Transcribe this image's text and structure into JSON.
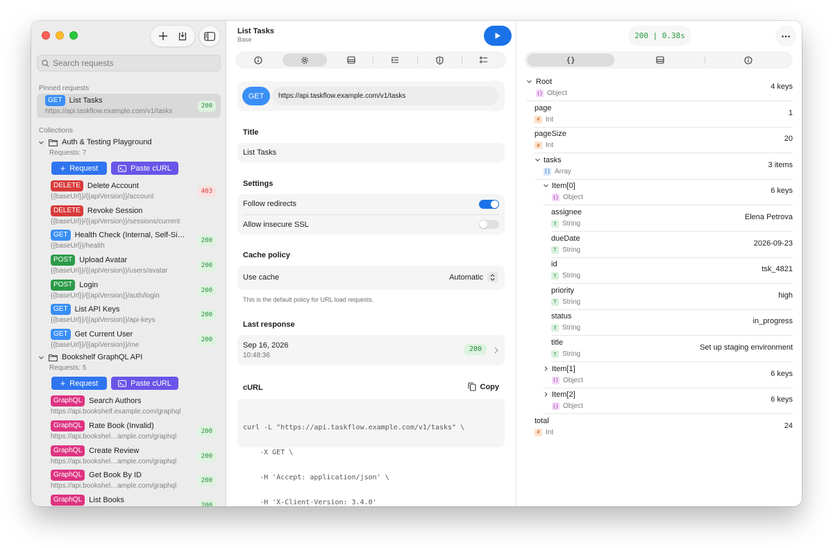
{
  "sidebar": {
    "search_placeholder": "Search requests",
    "pinned_label": "Pinned requests",
    "collections_label": "Collections",
    "pinned": {
      "method": "GET",
      "name": "List Tasks",
      "url": "https://api.taskflow.example.com/v1/tasks",
      "code": "200"
    },
    "collections": [
      {
        "name": "Auth & Testing Playground",
        "count": "Requests: 7",
        "request_btn": "Request",
        "curl_btn": "Paste cURL",
        "items": [
          {
            "method": "DELETE",
            "name": "Delete Account",
            "url": "{{baseUrl}}/{{apiVersion}}/account",
            "code": "403"
          },
          {
            "method": "DELETE",
            "name": "Revoke Session",
            "url": "{{baseUrl}}/{{apiVersion}}/sessions/current",
            "code": ""
          },
          {
            "method": "GET",
            "name": "Health Check (Internal, Self-Si…",
            "url": "{{baseUrl}}/health",
            "code": "200"
          },
          {
            "method": "POST",
            "name": "Upload Avatar",
            "url": "{{baseUrl}}/{{apiVersion}}/users/avatar",
            "code": "200"
          },
          {
            "method": "POST",
            "name": "Login",
            "url": "{{baseUrl}}/{{apiVersion}}/auth/login",
            "code": "200"
          },
          {
            "method": "GET",
            "name": "List API Keys",
            "url": "{{baseUrl}}/{{apiVersion}}/api-keys",
            "code": "200"
          },
          {
            "method": "GET",
            "name": "Get Current User",
            "url": "{{baseUrl}}/{{apiVersion}}/me",
            "code": "200"
          }
        ]
      },
      {
        "name": "Bookshelf GraphQL API",
        "count": "Requests: 5",
        "request_btn": "Request",
        "curl_btn": "Paste cURL",
        "items": [
          {
            "method": "GraphQL",
            "name": "Search Authors",
            "url": "https://api.bookshelf.example.com/graphql",
            "code": ""
          },
          {
            "method": "GraphQL",
            "name": "Rate Book (Invalid)",
            "url": "https://api.bookshel…ample.com/graphql",
            "code": "200"
          },
          {
            "method": "GraphQL",
            "name": "Create Review",
            "url": "https://api.bookshel…ample.com/graphql",
            "code": "200"
          },
          {
            "method": "GraphQL",
            "name": "Get Book By ID",
            "url": "https://api.bookshel…ample.com/graphql",
            "code": "200"
          },
          {
            "method": "GraphQL",
            "name": "List Books",
            "url": "",
            "code": "200"
          }
        ]
      }
    ]
  },
  "request": {
    "title": "List Tasks",
    "subtitle": "Base",
    "method": "GET",
    "url": "https://api.taskflow.example.com/v1/tasks",
    "title_section": "Title",
    "title_value": "List Tasks",
    "settings_section": "Settings",
    "follow_redirects_label": "Follow redirects",
    "follow_redirects": true,
    "insecure_ssl_label": "Allow insecure SSL",
    "insecure_ssl": false,
    "cache_section": "Cache policy",
    "use_cache_label": "Use cache",
    "use_cache_value": "Automatic",
    "cache_hint": "This is the default policy for URL load requests.",
    "last_response_section": "Last response",
    "last_response_date": "Sep 16, 2026",
    "last_response_time": "10:48:36",
    "last_response_code": "200",
    "curl_section": "cURL",
    "copy_label": "Copy",
    "curl_lines": [
      "curl -L \"https://api.taskflow.example.com/v1/tasks\" \\",
      "    -X GET \\",
      "    -H 'Accept: application/json' \\",
      "    -H 'X-Client-Version: 3.4.0'"
    ]
  },
  "response": {
    "status": "200 | 0.38s",
    "tabs": [
      "{}",
      "body-icon",
      "info-icon"
    ],
    "tree": [
      {
        "key": "Root",
        "type": "Object",
        "badge": "{}",
        "value": "4 keys",
        "depth": 0,
        "chevron": "down"
      },
      {
        "key": "page",
        "type": "Int",
        "badge": "#",
        "value": "1",
        "depth": 1,
        "chevron": ""
      },
      {
        "key": "pageSize",
        "type": "Int",
        "badge": "#",
        "value": "20",
        "depth": 1,
        "chevron": ""
      },
      {
        "key": "tasks",
        "type": "Array",
        "badge": "[]",
        "value": "3 items",
        "depth": 1,
        "chevron": "down"
      },
      {
        "key": "Item[0]",
        "type": "Object",
        "badge": "{}",
        "value": "6 keys",
        "depth": 2,
        "chevron": "down"
      },
      {
        "key": "assignee",
        "type": "String",
        "badge": "T",
        "value": "Elena Petrova",
        "depth": 3,
        "chevron": ""
      },
      {
        "key": "dueDate",
        "type": "String",
        "badge": "T",
        "value": "2026-09-23",
        "depth": 3,
        "chevron": ""
      },
      {
        "key": "id",
        "type": "String",
        "badge": "T",
        "value": "tsk_4821",
        "depth": 3,
        "chevron": ""
      },
      {
        "key": "priority",
        "type": "String",
        "badge": "T",
        "value": "high",
        "depth": 3,
        "chevron": ""
      },
      {
        "key": "status",
        "type": "String",
        "badge": "T",
        "value": "in_progress",
        "depth": 3,
        "chevron": ""
      },
      {
        "key": "title",
        "type": "String",
        "badge": "T",
        "value": "Set up staging environment",
        "depth": 3,
        "chevron": ""
      },
      {
        "key": "Item[1]",
        "type": "Object",
        "badge": "{}",
        "value": "6 keys",
        "depth": 2,
        "chevron": "right"
      },
      {
        "key": "Item[2]",
        "type": "Object",
        "badge": "{}",
        "value": "6 keys",
        "depth": 2,
        "chevron": "right"
      },
      {
        "key": "total",
        "type": "Int",
        "badge": "#",
        "value": "24",
        "depth": 1,
        "chevron": ""
      }
    ]
  },
  "colors": {
    "accent": "#1a73e8",
    "get": "#3a8ff5",
    "post": "#2b9a48",
    "delete": "#d93b3b",
    "graphql": "#de3481"
  }
}
